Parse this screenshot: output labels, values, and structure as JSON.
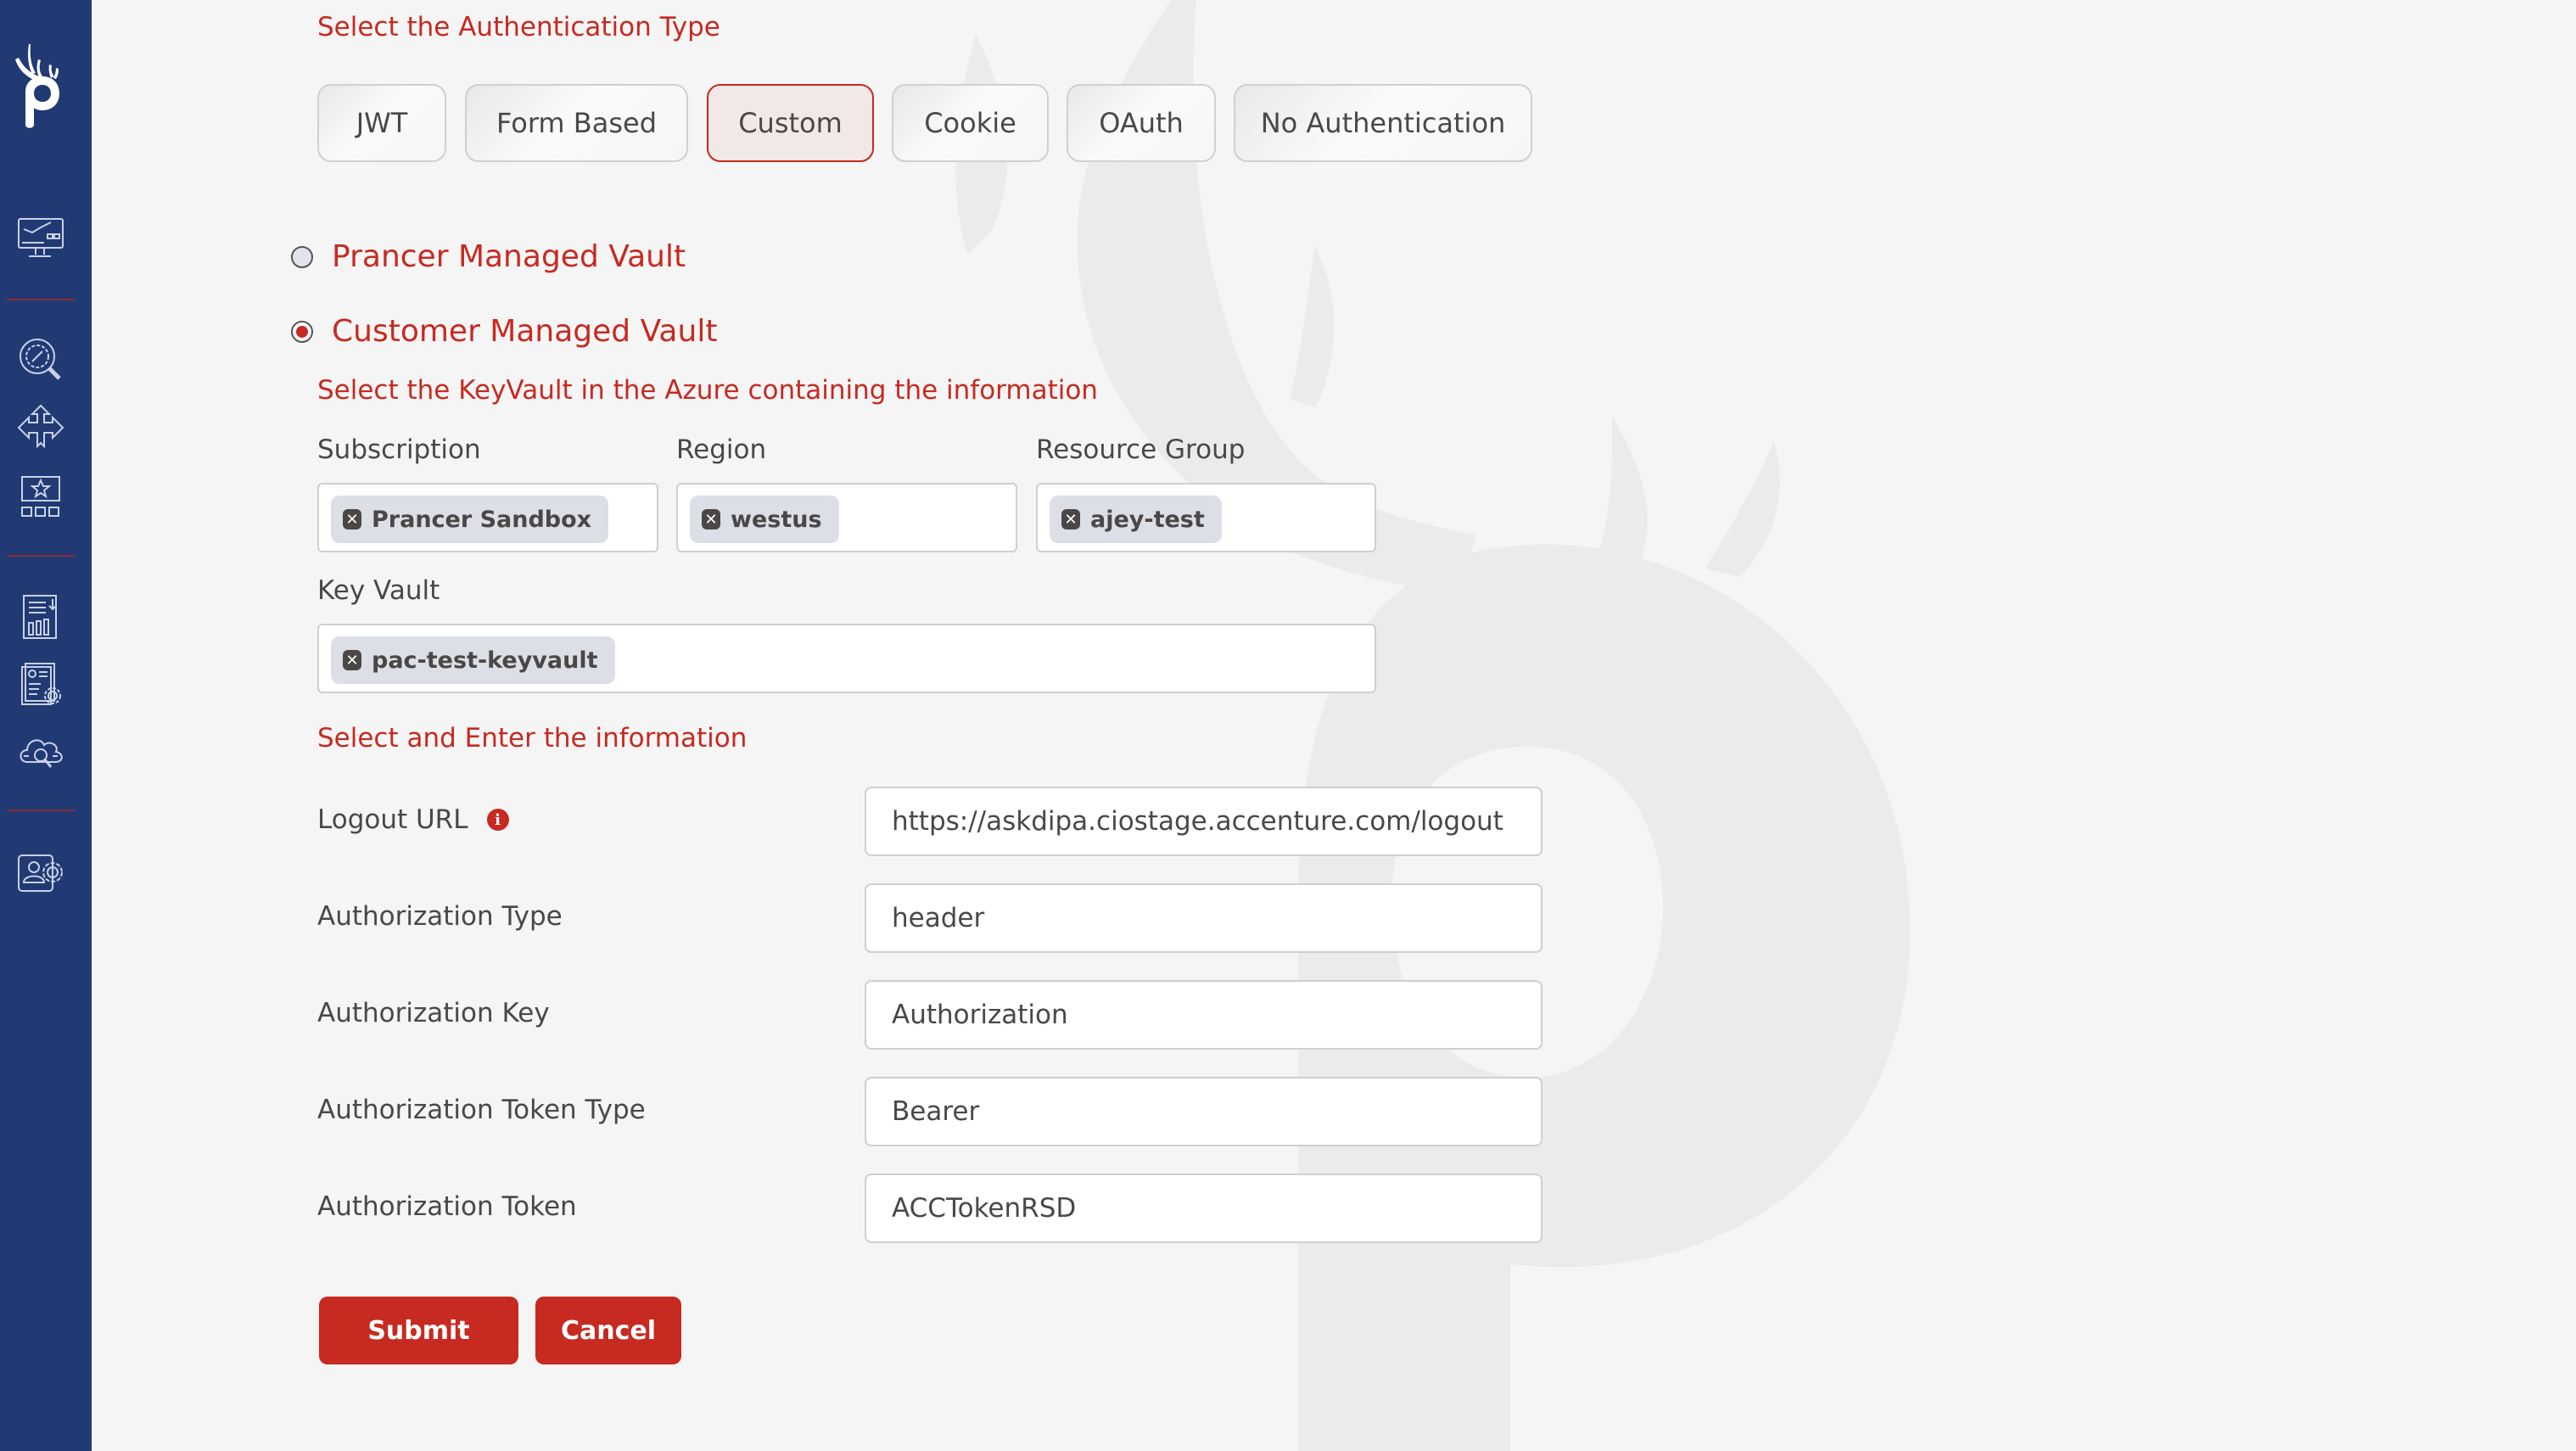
{
  "sidebar": {
    "logo": "prancer-logo",
    "groups": [
      [
        {
          "icon": "dashboard-monitor-icon"
        }
      ],
      [
        {
          "icon": "security-search-icon"
        },
        {
          "icon": "directions-arrows-icon"
        },
        {
          "icon": "favorites-grid-icon"
        }
      ],
      [
        {
          "icon": "report-download-icon"
        },
        {
          "icon": "document-settings-icon"
        },
        {
          "icon": "cloud-search-icon"
        }
      ],
      [
        {
          "icon": "user-settings-icon"
        }
      ]
    ]
  },
  "auth": {
    "heading": "Select the Authentication Type",
    "types": [
      "JWT",
      "Form Based",
      "Custom",
      "Cookie",
      "OAuth",
      "No Authentication"
    ],
    "selected": "Custom"
  },
  "vault": {
    "options": [
      {
        "label": "Prancer Managed Vault",
        "checked": false
      },
      {
        "label": "Customer Managed Vault",
        "checked": true
      }
    ],
    "keyvault_heading": "Select the KeyVault in the Azure containing the information",
    "subscription": {
      "label": "Subscription",
      "value": "Prancer Sandbox"
    },
    "region": {
      "label": "Region",
      "value": "westus"
    },
    "resource_group": {
      "label": "Resource Group",
      "value": "ajey-test"
    },
    "key_vault": {
      "label": "Key Vault",
      "value": "pac-test-keyvault"
    },
    "chip_remove_glyph": "✕"
  },
  "info": {
    "heading": "Select and Enter the information",
    "info_glyph": "i",
    "fields": [
      {
        "label": "Logout URL",
        "value": "https://askdipa.ciostage.accenture.com/logout",
        "has_info": true
      },
      {
        "label": "Authorization Type",
        "value": "header"
      },
      {
        "label": "Authorization Key",
        "value": "Authorization"
      },
      {
        "label": "Authorization Token Type",
        "value": "Bearer"
      },
      {
        "label": "Authorization Token",
        "value": "ACCTokenRSD"
      }
    ]
  },
  "actions": {
    "submit": "Submit",
    "cancel": "Cancel"
  },
  "colors": {
    "sidebar": "#213a74",
    "accent": "#c62a21",
    "background": "#f5f5f5"
  }
}
